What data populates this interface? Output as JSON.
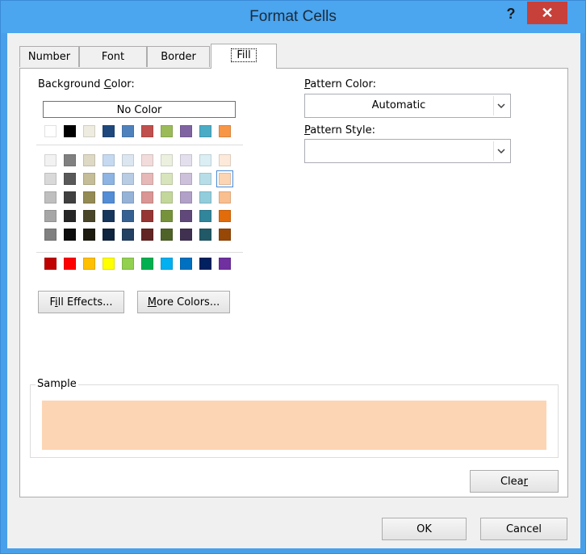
{
  "window": {
    "title": "Format Cells",
    "help_label": "?",
    "close_label": "✕"
  },
  "tabs": [
    {
      "label": "Number"
    },
    {
      "label": "Font"
    },
    {
      "label": "Border"
    },
    {
      "label": "Fill",
      "active": true
    }
  ],
  "background_color": {
    "label_pre": "Background ",
    "label_u": "C",
    "label_post": "olor:",
    "no_color_label": "No Color",
    "row1": [
      "#FFFFFF",
      "#000000",
      "#EEECE1",
      "#1F497D",
      "#4F81BD",
      "#C0504D",
      "#9BBB59",
      "#8064A2",
      "#4BACC6",
      "#F79646"
    ],
    "tints": [
      [
        "#F2F2F2",
        "#808080",
        "#DDD9C4",
        "#C5D9F1",
        "#DCE6F1",
        "#F2DCDB",
        "#EBF1DE",
        "#E4DFEC",
        "#DAEEF3",
        "#FDE9D9"
      ],
      [
        "#D9D9D9",
        "#595959",
        "#C4BD97",
        "#8DB4E2",
        "#B8CCE4",
        "#E6B8B7",
        "#D8E4BC",
        "#CCC0DA",
        "#B7DEE8",
        "#FCD5B4"
      ],
      [
        "#BFBFBF",
        "#404040",
        "#948A54",
        "#538DD5",
        "#95B3D7",
        "#DA9694",
        "#C4D79B",
        "#B1A0C7",
        "#92CDDC",
        "#FABF8F"
      ],
      [
        "#A6A6A6",
        "#262626",
        "#494529",
        "#16365C",
        "#366092",
        "#963634",
        "#76933C",
        "#60497A",
        "#31869B",
        "#E26B0A"
      ],
      [
        "#808080",
        "#0D0D0D",
        "#1D1B10",
        "#0F243E",
        "#244062",
        "#632523",
        "#4F6228",
        "#403151",
        "#215967",
        "#974706"
      ]
    ],
    "standard": [
      "#C00000",
      "#FF0000",
      "#FFC000",
      "#FFFF00",
      "#92D050",
      "#00B050",
      "#00B0F0",
      "#0070C0",
      "#002060",
      "#7030A0"
    ],
    "selected": "#FCD5B4"
  },
  "buttons": {
    "fill_effects_pre": "F",
    "fill_effects_u": "i",
    "fill_effects_post": "ll Effects...",
    "more_colors_u": "M",
    "more_colors_post": "ore Colors...",
    "clear_pre": "Clea",
    "clear_u": "r",
    "ok": "OK",
    "cancel": "Cancel"
  },
  "pattern": {
    "color_u": "P",
    "color_post": "attern Color:",
    "color_value": "Automatic",
    "style_u": "P",
    "style_post": "attern Style:",
    "style_value": ""
  },
  "sample": {
    "label": "Sample",
    "fill_color": "#FCD5B4"
  }
}
